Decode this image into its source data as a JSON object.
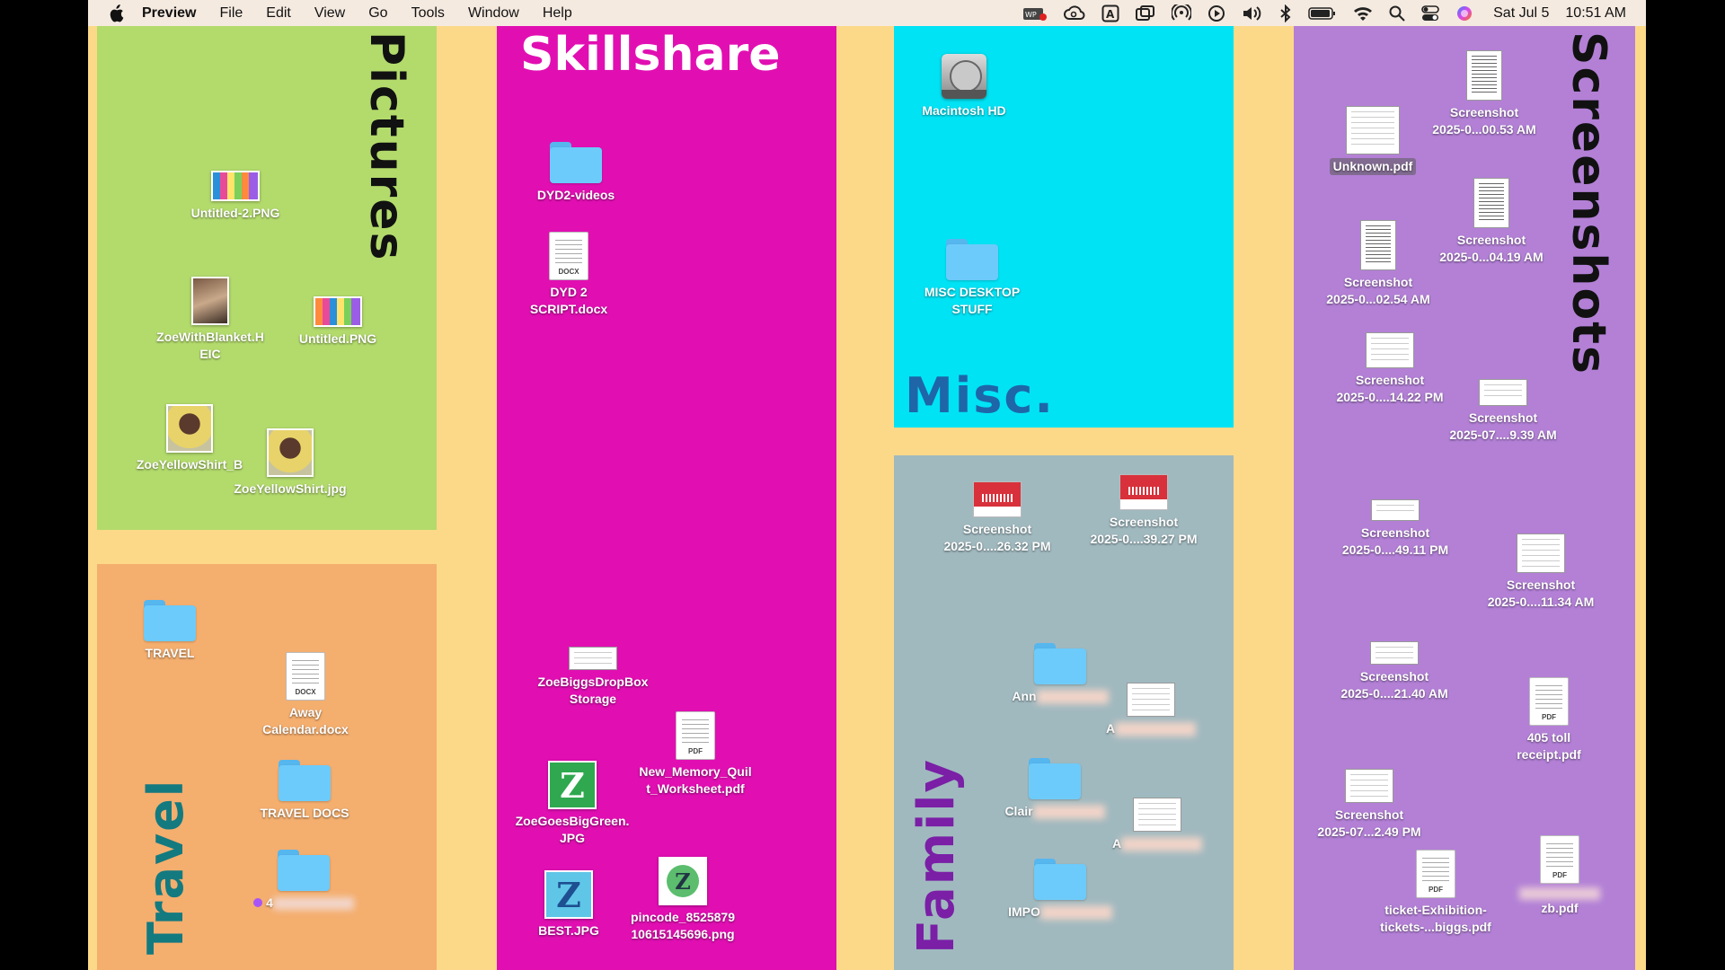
{
  "menubar": {
    "app_name": "Preview",
    "items": [
      "File",
      "Edit",
      "View",
      "Go",
      "Tools",
      "Window",
      "Help"
    ],
    "status_icons": [
      "wp-recorder-icon",
      "creative-cloud-icon",
      "keyboard-input-icon",
      "screen-mirror-icon",
      "airplay-icon",
      "play-icon",
      "volume-icon",
      "bluetooth-icon",
      "battery-icon",
      "wifi-icon",
      "search-icon",
      "control-center-icon",
      "siri-icon"
    ],
    "date": "Sat Jul 5",
    "time": "10:51 AM"
  },
  "colors": {
    "desktop_bg": "#FCD989",
    "pictures": "#B3DB6C",
    "skillshare": "#E10FB2",
    "misc": "#00E3F5",
    "family": "#A0B9BF",
    "screenshots": "#B380D6",
    "travel": "#F4AE6E"
  },
  "panels": {
    "pictures": {
      "title": "Pictures"
    },
    "skillshare": {
      "title": "Skillshare"
    },
    "misc": {
      "title": "Misc."
    },
    "family": {
      "title": "Family"
    },
    "screenshots": {
      "title": "Screenshots"
    },
    "travel": {
      "title": "Travel"
    }
  },
  "icons": {
    "pictures": [
      {
        "label": "Untitled-2.PNG",
        "kind": "image"
      },
      {
        "label": "ZoeWithBlanket.H\nEIC",
        "kind": "image"
      },
      {
        "label": "Untitled.PNG",
        "kind": "image"
      },
      {
        "label": "ZoeYellowShirt_B",
        "kind": "image"
      },
      {
        "label": "ZoeYellowShirt.jpg",
        "kind": "image"
      }
    ],
    "skillshare": [
      {
        "label": "DYD2-videos",
        "kind": "folder"
      },
      {
        "label": "DYD 2\nSCRIPT.docx",
        "kind": "docx"
      },
      {
        "label": "ZoeBiggsDropBox\nStorage",
        "kind": "image"
      },
      {
        "label": "New_Memory_Quil\nt_Worksheet.pdf",
        "kind": "pdf"
      },
      {
        "label": "ZoeGoesBigGreen.\nJPG",
        "kind": "image"
      },
      {
        "label": "BEST.JPG",
        "kind": "image"
      },
      {
        "label": "pincode_8525879\n10615145696.png",
        "kind": "image"
      }
    ],
    "misc": [
      {
        "label": "Macintosh HD",
        "kind": "drive"
      },
      {
        "label": "MISC DESKTOP\nSTUFF",
        "kind": "folder"
      }
    ],
    "family": [
      {
        "label": "Screenshot\n2025-0....26.32 PM",
        "kind": "screenshot"
      },
      {
        "label": "Screenshot\n2025-0....39.27 PM",
        "kind": "screenshot"
      },
      {
        "label": "Ann",
        "kind": "folder"
      },
      {
        "label": "A",
        "kind": "image"
      },
      {
        "label": "Clair",
        "kind": "folder"
      },
      {
        "label": "A",
        "kind": "image"
      },
      {
        "label": "IMPO",
        "kind": "folder"
      }
    ],
    "screenshots": [
      {
        "label": "Screenshot\n2025-0...00.53 AM",
        "kind": "screenshot"
      },
      {
        "label": "Unknown.pdf",
        "kind": "pdf"
      },
      {
        "label": "Screenshot\n2025-0...04.19 AM",
        "kind": "screenshot"
      },
      {
        "label": "Screenshot\n2025-0...02.54 AM",
        "kind": "screenshot"
      },
      {
        "label": "Screenshot\n2025-0....14.22 PM",
        "kind": "screenshot"
      },
      {
        "label": "Screenshot\n2025-07....9.39 AM",
        "kind": "screenshot"
      },
      {
        "label": "Screenshot\n2025-0....49.11 PM",
        "kind": "screenshot"
      },
      {
        "label": "Screenshot\n2025-0....11.34 AM",
        "kind": "screenshot"
      },
      {
        "label": "Screenshot\n2025-0....21.40 AM",
        "kind": "screenshot"
      },
      {
        "label": "405 toll\nreceipt.pdf",
        "kind": "pdf"
      },
      {
        "label": "Screenshot\n2025-07...2.49 PM",
        "kind": "screenshot"
      },
      {
        "label": "ticket-Exhibition-\ntickets-...biggs.pdf",
        "kind": "pdf"
      },
      {
        "label": "zb.pdf",
        "kind": "pdf"
      }
    ],
    "travel": [
      {
        "label": "TRAVEL",
        "kind": "folder"
      },
      {
        "label": "Away\nCalendar.docx",
        "kind": "docx"
      },
      {
        "label": "TRAVEL DOCS",
        "kind": "folder"
      },
      {
        "label": "4",
        "kind": "folder"
      }
    ]
  },
  "file_tags": {
    "docx": "DOCX",
    "pdf": "PDF"
  }
}
